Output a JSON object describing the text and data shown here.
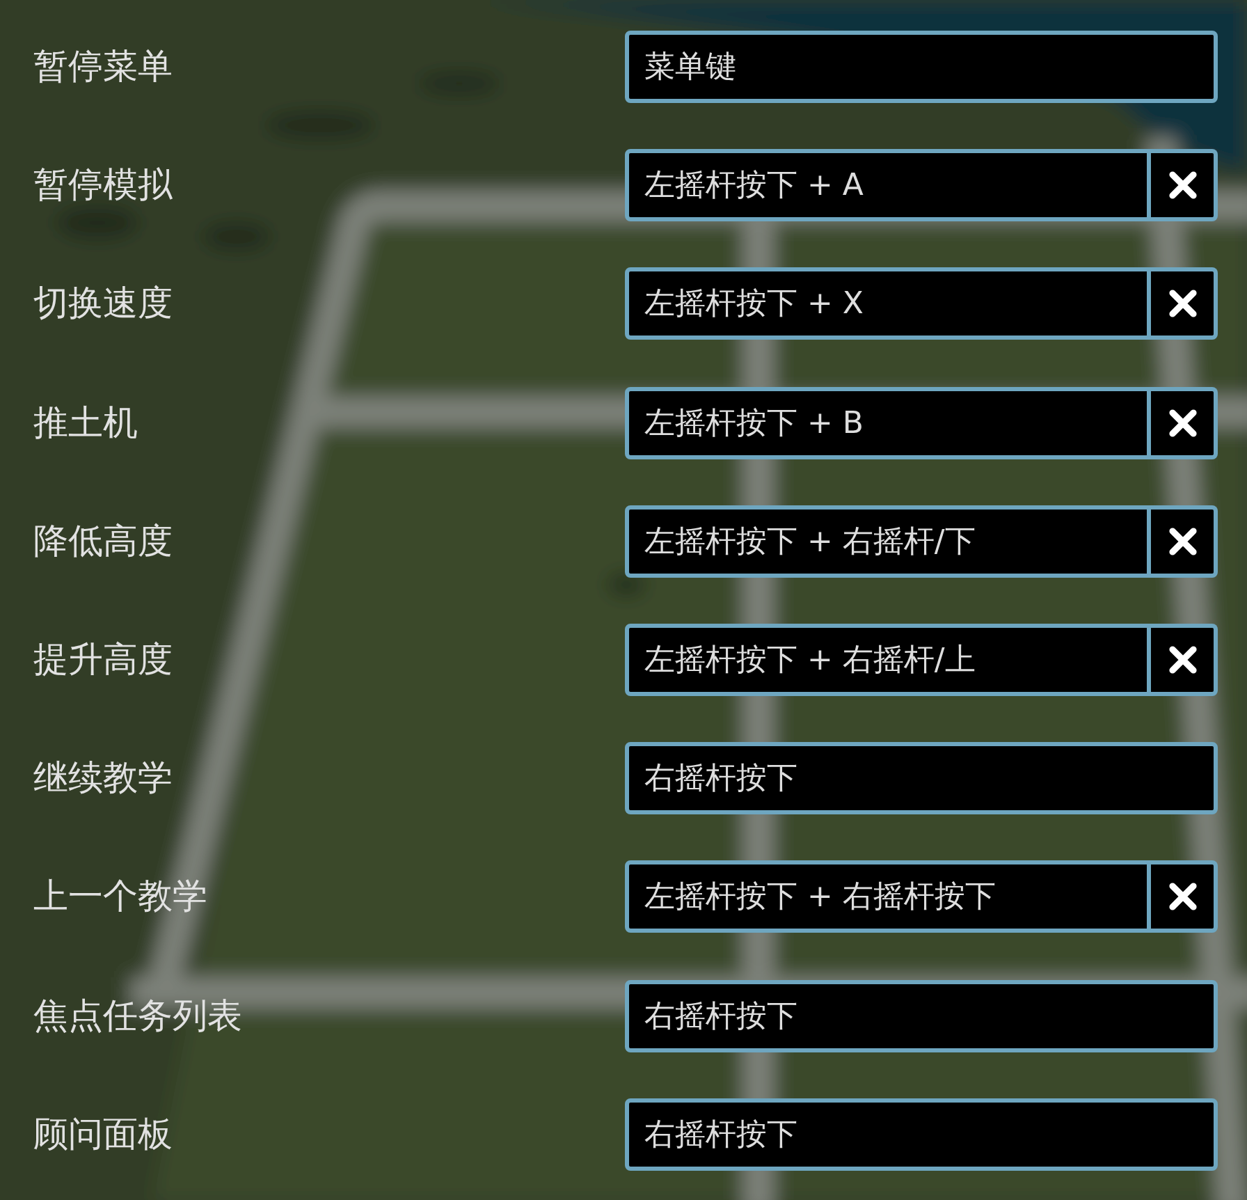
{
  "bindings": [
    {
      "label": "暂停菜单",
      "value": "菜单键",
      "removable": false
    },
    {
      "label": "暂停模拟",
      "value": "左摇杆按下 + A",
      "removable": true
    },
    {
      "label": "切换速度",
      "value": "左摇杆按下 + X",
      "removable": true
    },
    {
      "label": "推土机",
      "value": "左摇杆按下 + B",
      "removable": true
    },
    {
      "label": "降低高度",
      "value": "左摇杆按下 + 右摇杆/下",
      "removable": true
    },
    {
      "label": "提升高度",
      "value": "左摇杆按下 + 右摇杆/上",
      "removable": true
    },
    {
      "label": "继续教学",
      "value": "右摇杆按下",
      "removable": false
    },
    {
      "label": "上一个教学",
      "value": "左摇杆按下 + 右摇杆按下",
      "removable": true
    },
    {
      "label": "焦点任务列表",
      "value": "右摇杆按下",
      "removable": false
    },
    {
      "label": "顾问面板",
      "value": "右摇杆按下",
      "removable": false
    }
  ]
}
